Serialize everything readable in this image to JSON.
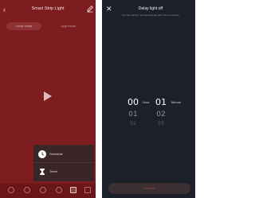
{
  "left": {
    "title": "Smart Strip Light",
    "modes": [
      "Local mode",
      "App mode"
    ],
    "popup": {
      "schedule": "Schedule",
      "timer": "Timer"
    }
  },
  "right": {
    "title": "Delay light off",
    "subtitle": "The light will turn off automatically after the countdown.",
    "hours": {
      "selected": "00",
      "next1": "01",
      "next2": "02",
      "unit": "Hour"
    },
    "minutes": {
      "selected": "01",
      "next1": "02",
      "next2": "03",
      "unit": "Minute"
    },
    "confirm_label": "Confirm"
  },
  "colors": {
    "left_bg": "#7d1d1f",
    "right_bg": "#1c2029",
    "accent": "#b04b50"
  }
}
